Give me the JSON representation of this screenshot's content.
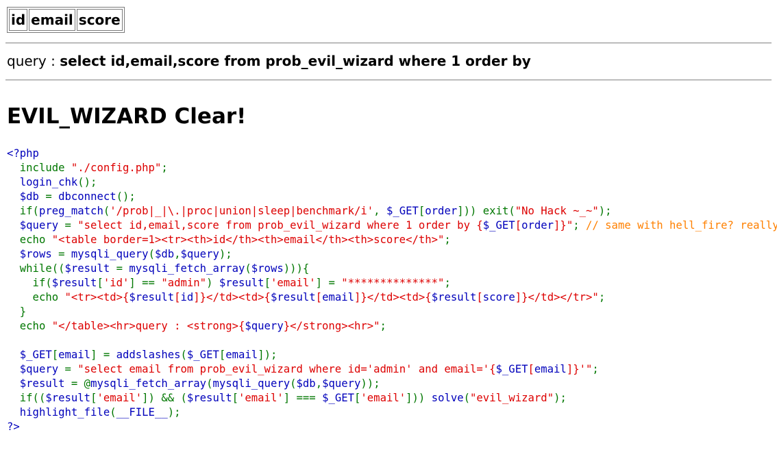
{
  "table": {
    "headers": [
      "id",
      "email",
      "score"
    ]
  },
  "query": {
    "label": "query : ",
    "sql": "select id,email,score from prob_evil_wizard where 1 order by"
  },
  "heading": "EVIL_WIZARD Clear!",
  "source": {
    "open_tag": "<?php",
    "close_tag": "?>",
    "lines": [
      [
        [
          "k",
          "  include "
        ],
        [
          "s",
          "\"./config.php\""
        ],
        [
          "k",
          ";"
        ]
      ],
      [
        [
          "d",
          "  login_chk"
        ],
        [
          "k",
          "();"
        ]
      ],
      [
        [
          "d",
          "  $db "
        ],
        [
          "k",
          "= "
        ],
        [
          "d",
          "dbconnect"
        ],
        [
          "k",
          "();"
        ]
      ],
      [
        [
          "k",
          "  if("
        ],
        [
          "d",
          "preg_match"
        ],
        [
          "k",
          "("
        ],
        [
          "s",
          "'/prob|_|\\.|proc|union|sleep|benchmark/i'"
        ],
        [
          "k",
          ", "
        ],
        [
          "d",
          "$_GET"
        ],
        [
          "k",
          "["
        ],
        [
          "d",
          "order"
        ],
        [
          "k",
          "])) exit("
        ],
        [
          "s",
          "\"No Hack ~_~\""
        ],
        [
          "k",
          ");"
        ]
      ],
      [
        [
          "d",
          "  $query "
        ],
        [
          "k",
          "= "
        ],
        [
          "s",
          "\"select id,email,score from prob_evil_wizard where 1 order by {"
        ],
        [
          "d",
          "$_GET"
        ],
        [
          "s",
          "["
        ],
        [
          "d",
          "order"
        ],
        [
          "s",
          "]}\""
        ],
        [
          "k",
          "; "
        ],
        [
          "c",
          "// same with hell_fire? really?"
        ]
      ],
      [
        [
          "k",
          "  echo "
        ],
        [
          "s",
          "\"<table border=1><tr><th>id</th><th>email</th><th>score</th>\""
        ],
        [
          "k",
          ";"
        ]
      ],
      [
        [
          "d",
          "  $rows "
        ],
        [
          "k",
          "= "
        ],
        [
          "d",
          "mysqli_query"
        ],
        [
          "k",
          "("
        ],
        [
          "d",
          "$db"
        ],
        [
          "k",
          ","
        ],
        [
          "d",
          "$query"
        ],
        [
          "k",
          ");"
        ]
      ],
      [
        [
          "k",
          "  while(("
        ],
        [
          "d",
          "$result "
        ],
        [
          "k",
          "= "
        ],
        [
          "d",
          "mysqli_fetch_array"
        ],
        [
          "k",
          "("
        ],
        [
          "d",
          "$rows"
        ],
        [
          "k",
          "))){"
        ]
      ],
      [
        [
          "k",
          "    if("
        ],
        [
          "d",
          "$result"
        ],
        [
          "k",
          "["
        ],
        [
          "s",
          "'id'"
        ],
        [
          "k",
          "] == "
        ],
        [
          "s",
          "\"admin\""
        ],
        [
          "k",
          ") "
        ],
        [
          "d",
          "$result"
        ],
        [
          "k",
          "["
        ],
        [
          "s",
          "'email'"
        ],
        [
          "k",
          "] = "
        ],
        [
          "s",
          "\"**************\""
        ],
        [
          "k",
          ";"
        ]
      ],
      [
        [
          "k",
          "    echo "
        ],
        [
          "s",
          "\"<tr><td>{"
        ],
        [
          "d",
          "$result"
        ],
        [
          "s",
          "["
        ],
        [
          "d",
          "id"
        ],
        [
          "s",
          "]}</td><td>{"
        ],
        [
          "d",
          "$result"
        ],
        [
          "s",
          "["
        ],
        [
          "d",
          "email"
        ],
        [
          "s",
          "]}</td><td>{"
        ],
        [
          "d",
          "$result"
        ],
        [
          "s",
          "["
        ],
        [
          "d",
          "score"
        ],
        [
          "s",
          "]}</td></tr>\""
        ],
        [
          "k",
          ";"
        ]
      ],
      [
        [
          "k",
          "  }"
        ]
      ],
      [
        [
          "k",
          "  echo "
        ],
        [
          "s",
          "\"</table><hr>query : <strong>{"
        ],
        [
          "d",
          "$query"
        ],
        [
          "s",
          "}</strong><hr>\""
        ],
        [
          "k",
          ";"
        ]
      ],
      [
        [
          "k",
          ""
        ]
      ],
      [
        [
          "d",
          "  $_GET"
        ],
        [
          "k",
          "["
        ],
        [
          "d",
          "email"
        ],
        [
          "k",
          "] = "
        ],
        [
          "d",
          "addslashes"
        ],
        [
          "k",
          "("
        ],
        [
          "d",
          "$_GET"
        ],
        [
          "k",
          "["
        ],
        [
          "d",
          "email"
        ],
        [
          "k",
          "]);"
        ]
      ],
      [
        [
          "d",
          "  $query "
        ],
        [
          "k",
          "= "
        ],
        [
          "s",
          "\"select email from prob_evil_wizard where id='admin' and email='{"
        ],
        [
          "d",
          "$_GET"
        ],
        [
          "s",
          "["
        ],
        [
          "d",
          "email"
        ],
        [
          "s",
          "]}'\""
        ],
        [
          "k",
          ";"
        ]
      ],
      [
        [
          "d",
          "  $result "
        ],
        [
          "k",
          "= @"
        ],
        [
          "d",
          "mysqli_fetch_array"
        ],
        [
          "k",
          "("
        ],
        [
          "d",
          "mysqli_query"
        ],
        [
          "k",
          "("
        ],
        [
          "d",
          "$db"
        ],
        [
          "k",
          ","
        ],
        [
          "d",
          "$query"
        ],
        [
          "k",
          "));"
        ]
      ],
      [
        [
          "k",
          "  if(("
        ],
        [
          "d",
          "$result"
        ],
        [
          "k",
          "["
        ],
        [
          "s",
          "'email'"
        ],
        [
          "k",
          "]) && ("
        ],
        [
          "d",
          "$result"
        ],
        [
          "k",
          "["
        ],
        [
          "s",
          "'email'"
        ],
        [
          "k",
          "] === "
        ],
        [
          "d",
          "$_GET"
        ],
        [
          "k",
          "["
        ],
        [
          "s",
          "'email'"
        ],
        [
          "k",
          "])) "
        ],
        [
          "d",
          "solve"
        ],
        [
          "k",
          "("
        ],
        [
          "s",
          "\"evil_wizard\""
        ],
        [
          "k",
          ");"
        ]
      ],
      [
        [
          "d",
          "  highlight_file"
        ],
        [
          "k",
          "("
        ],
        [
          "d",
          "__FILE__"
        ],
        [
          "k",
          ");"
        ]
      ]
    ]
  }
}
